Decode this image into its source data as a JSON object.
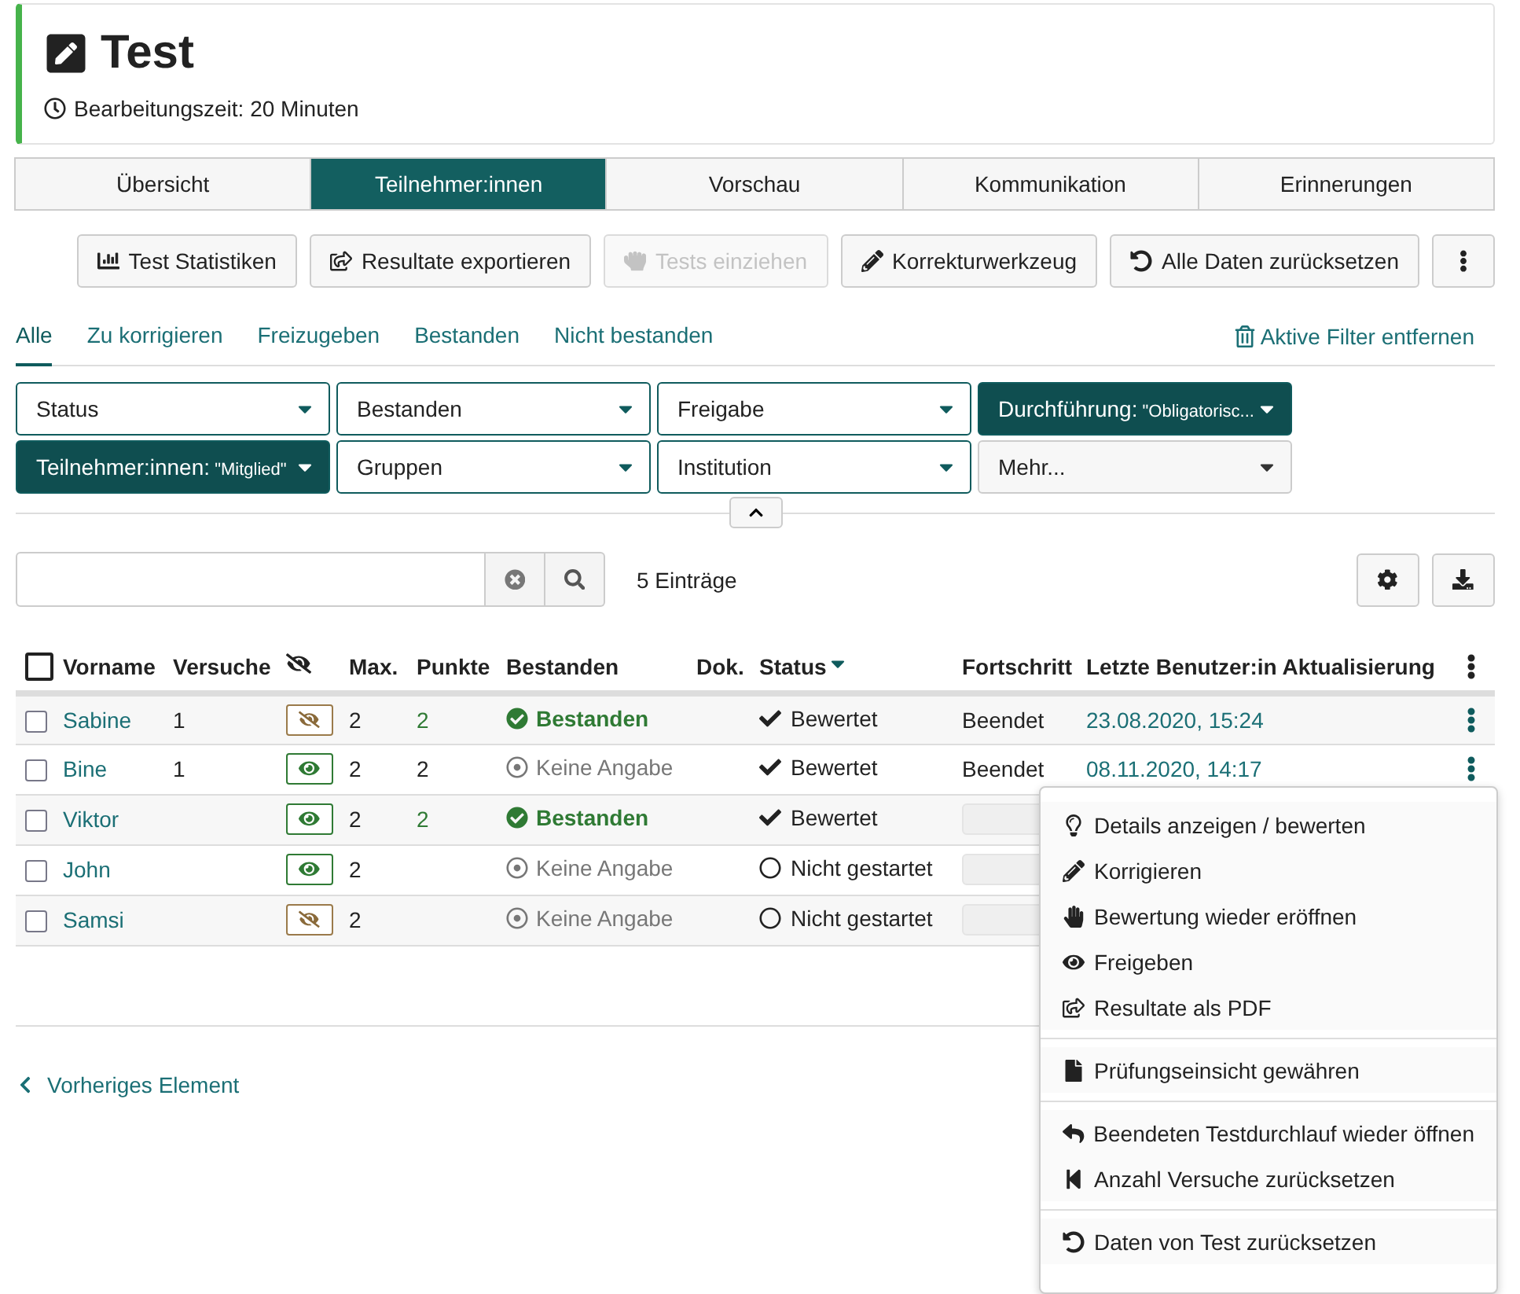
{
  "header": {
    "title": "Test",
    "meta": "Bearbeitungszeit: 20 Minuten"
  },
  "tabs": [
    {
      "label": "Übersicht",
      "selected": false
    },
    {
      "label": "Teilnehmer:innen",
      "selected": true
    },
    {
      "label": "Vorschau",
      "selected": false
    },
    {
      "label": "Kommunikation",
      "selected": false
    },
    {
      "label": "Erinnerungen",
      "selected": false
    }
  ],
  "toolbar": [
    {
      "label": "Test Statistiken",
      "disabled": false
    },
    {
      "label": "Resultate exportieren",
      "disabled": false
    },
    {
      "label": "Tests einziehen",
      "disabled": true
    },
    {
      "label": "Korrekturwerkzeug",
      "disabled": false
    },
    {
      "label": "Alle Daten zurücksetzen",
      "disabled": false
    }
  ],
  "filter_tabs": [
    {
      "label": "Alle",
      "selected": true
    },
    {
      "label": "Zu korrigieren",
      "selected": false
    },
    {
      "label": "Freizugeben",
      "selected": false
    },
    {
      "label": "Bestanden",
      "selected": false
    },
    {
      "label": "Nicht bestanden",
      "selected": false
    }
  ],
  "clear_filters": "Aktive Filter entfernen",
  "filters": [
    {
      "label": "Status",
      "active": false
    },
    {
      "label": "Bestanden",
      "active": false
    },
    {
      "label": "Freigabe",
      "active": false
    },
    {
      "label": "Durchführung:",
      "value": "\"Obligatorisc...",
      "active": true
    },
    {
      "label": "Teilnehmer:innen:",
      "value": "\"Mitglied\"",
      "active": true
    },
    {
      "label": "Gruppen",
      "active": false
    },
    {
      "label": "Institution",
      "active": false
    },
    {
      "label": "Mehr...",
      "active": false,
      "kind": "more"
    }
  ],
  "count": "5 Einträge",
  "table": {
    "select_all": {
      "checked": false
    },
    "columns": [
      {
        "kind": "text",
        "label": "Vorname",
        "sorted": false
      },
      {
        "kind": "text",
        "label": "Versuche",
        "sorted": false
      },
      {
        "kind": "icon"
      },
      {
        "kind": "text",
        "label": "Max.",
        "sorted": false
      },
      {
        "kind": "text",
        "label": "Punkte",
        "sorted": false
      },
      {
        "kind": "text",
        "label": "Bestanden",
        "sorted": false
      },
      {
        "kind": "text",
        "label": "Dok.",
        "sorted": false
      },
      {
        "kind": "text",
        "label": "Status",
        "sorted": true
      },
      {
        "kind": "text",
        "label": "Fortschritt",
        "sorted": false
      },
      {
        "kind": "text",
        "label": "Letzte Benutzer:in Aktualisierung",
        "sorted": false
      }
    ],
    "rows": [
      {
        "checked": false,
        "name": "Sabine",
        "attempts": "1",
        "released": false,
        "max": "2",
        "points": "2",
        "passed": true,
        "result": "Bestanden",
        "done": true,
        "status": "Bewertet",
        "progress": {
          "kind": "text",
          "text": "Beendet"
        },
        "updated": "23.08.2020, 15:24",
        "menu_button": true
      },
      {
        "checked": false,
        "name": "Bine",
        "attempts": "1",
        "released": true,
        "max": "2",
        "points": "2",
        "passed": false,
        "result": "Keine Angabe",
        "done": true,
        "status": "Bewertet",
        "progress": {
          "kind": "text",
          "text": "Beendet"
        },
        "updated": "08.11.2020, 14:17",
        "menu_button": true
      },
      {
        "checked": false,
        "name": "Viktor",
        "released": true,
        "max": "2",
        "points": "2",
        "passed": true,
        "result": "Bestanden",
        "done": true,
        "status": "Bewertet",
        "progress": {
          "kind": "bar",
          "level": 0
        }
      },
      {
        "checked": false,
        "name": "John",
        "released": true,
        "max": "2",
        "passed": false,
        "result": "Keine Angabe",
        "done": false,
        "status": "Nicht gestartet",
        "progress": {
          "kind": "bar",
          "level": 0
        }
      },
      {
        "checked": false,
        "name": "Samsi",
        "released": false,
        "max": "2",
        "passed": false,
        "result": "Keine Angabe",
        "done": false,
        "status": "Nicht gestartet",
        "progress": {
          "kind": "bar",
          "level": 0
        }
      }
    ]
  },
  "back_link": "Vorheriges Element",
  "context_menu": {
    "groups": [
      [
        "Details anzeigen / bewerten",
        "Korrigieren",
        "Bewertung wieder eröffnen",
        "Freigeben",
        "Resultate als PDF"
      ],
      [
        "Prüfungseinsicht gewähren"
      ],
      [
        "Beendeten Testdurchlauf wieder öffnen",
        "Anzahl Versuche zurücksetzen"
      ],
      [
        "Daten von Test zurücksetzen"
      ]
    ]
  }
}
